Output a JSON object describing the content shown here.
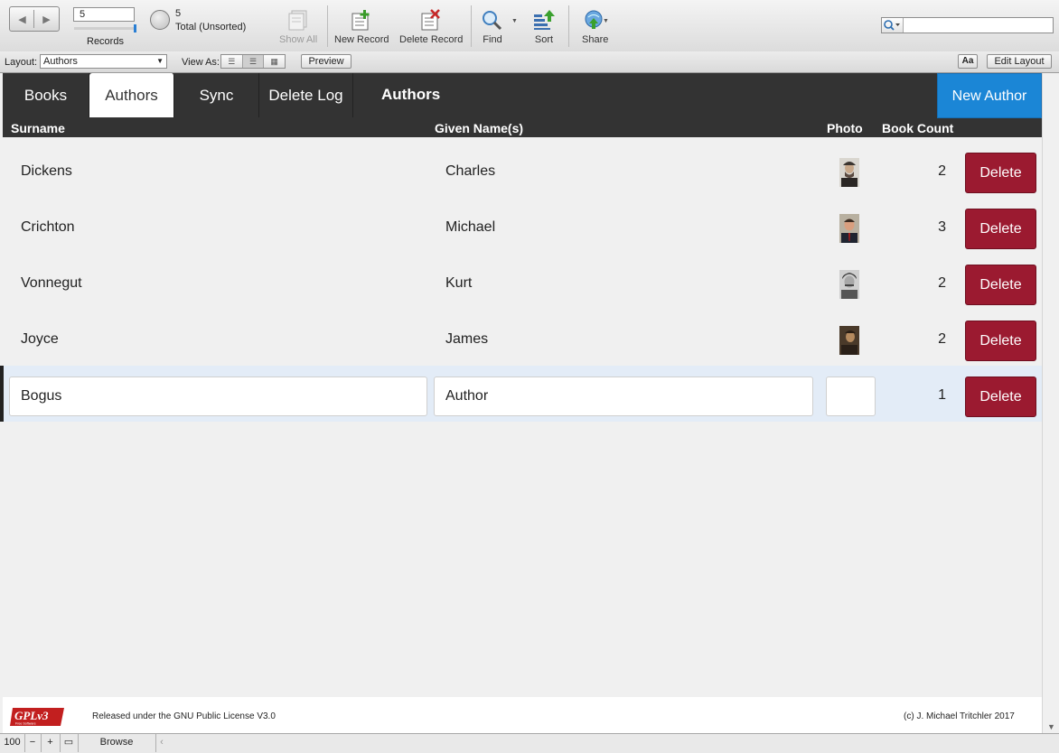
{
  "toolbar": {
    "record_current": "5",
    "records_label": "Records",
    "found_count": "5",
    "found_status": "Total (Unsorted)",
    "show_all": "Show All",
    "new_record": "New Record",
    "delete_record": "Delete Record",
    "find": "Find",
    "sort": "Sort",
    "share": "Share",
    "search_placeholder": ""
  },
  "layout_bar": {
    "layout_label": "Layout:",
    "layout_value": "Authors",
    "view_as_label": "View As:",
    "preview_label": "Preview",
    "text_format_label": "Aa",
    "edit_layout_label": "Edit Layout"
  },
  "nav": {
    "tabs": [
      "Books",
      "Authors",
      "Sync",
      "Delete Log"
    ],
    "active_tab": "Authors",
    "title": "Authors",
    "new_author_label": "New Author"
  },
  "columns": {
    "surname": "Surname",
    "given": "Given Name(s)",
    "photo": "Photo",
    "count": "Book Count"
  },
  "rows": [
    {
      "surname": "Dickens",
      "given": "Charles",
      "count": "2",
      "has_photo": true
    },
    {
      "surname": "Crichton",
      "given": "Michael",
      "count": "3",
      "has_photo": true
    },
    {
      "surname": "Vonnegut",
      "given": "Kurt",
      "count": "2",
      "has_photo": true
    },
    {
      "surname": "Joyce",
      "given": "James",
      "count": "2",
      "has_photo": true
    },
    {
      "surname": "Bogus",
      "given": "Author",
      "count": "1",
      "has_photo": false
    }
  ],
  "delete_label": "Delete",
  "footer": {
    "logo_text": "GPLv3",
    "logo_subtext": "Free Software",
    "license": "Released under the GNU Public License V3.0",
    "copyright": "(c) J. Michael Tritchler 2017"
  },
  "statusbar": {
    "zoom": "100",
    "mode": "Browse"
  },
  "colors": {
    "nav_bg": "#333333",
    "new_author_bg": "#1b86d6",
    "delete_bg": "#9b1a30",
    "current_row_bg": "#e3ecf7"
  }
}
